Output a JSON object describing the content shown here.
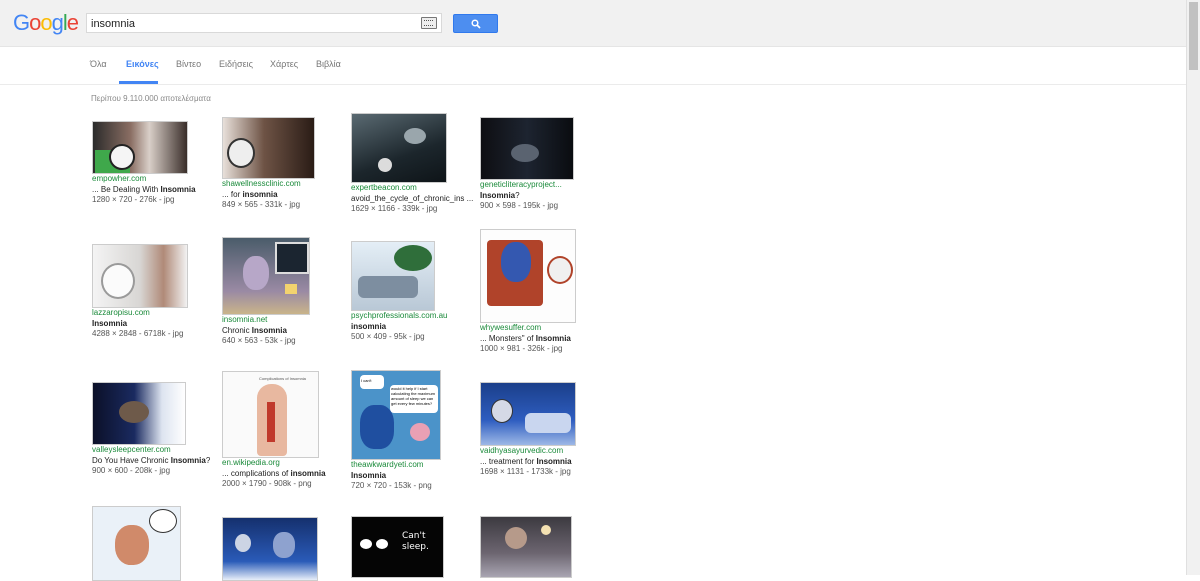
{
  "header": {
    "logo_text": "Google",
    "search_value": "insomnia"
  },
  "tabs": [
    "Όλα",
    "Εικόνες",
    "Βίντεο",
    "Ειδήσεις",
    "Χάρτες",
    "Βιβλία"
  ],
  "result_count": "Περίπου 9.110.000 αποτελέσματα",
  "results": [
    {
      "source": "empowher.com",
      "caption_pre": "... Be Dealing With ",
      "caption_bold": "Insomnia",
      "caption_post": "",
      "meta": "1280 × 720 - 276k - jpg"
    },
    {
      "source": "shawellnessclinic.com",
      "caption_pre": "... for ",
      "caption_bold": "insomnia",
      "caption_post": "",
      "meta": "849 × 565 - 331k - jpg"
    },
    {
      "source": "expertbeacon.com",
      "caption_pre": "avoid_the_cycle_of_chronic_ins ...",
      "caption_bold": "",
      "caption_post": "",
      "meta": "1629 × 1166 - 339k - jpg"
    },
    {
      "source": "geneticliteracyproject...",
      "caption_pre": "",
      "caption_bold": "Insomnia",
      "caption_post": "?",
      "meta": "900 × 598 - 195k - jpg"
    },
    {
      "source": "lazzaropisu.com",
      "caption_pre": "",
      "caption_bold": "Insomnia",
      "caption_post": "",
      "meta": "4288 × 2848 - 6718k - jpg"
    },
    {
      "source": "insomnia.net",
      "caption_pre": "Chronic ",
      "caption_bold": "Insomnia",
      "caption_post": "",
      "meta": "640 × 563 - 53k - jpg"
    },
    {
      "source": "psychprofessionals.com.au",
      "caption_pre": "",
      "caption_bold": "insomnia",
      "caption_post": "",
      "meta": "500 × 409 - 95k - jpg"
    },
    {
      "source": "whywesuffer.com",
      "caption_pre": "... Monsters\" of ",
      "caption_bold": "Insomnia",
      "caption_post": "",
      "meta": "1000 × 981 - 326k - jpg"
    },
    {
      "source": "valleysleepcenter.com",
      "caption_pre": "Do You Have Chronic ",
      "caption_bold": "Insomnia",
      "caption_post": "?",
      "meta": "900 × 600 - 208k - jpg"
    },
    {
      "source": "en.wikipedia.org",
      "caption_pre": "... complications of ",
      "caption_bold": "insomnia",
      "caption_post": "",
      "meta": "2000 × 1790 - 908k - png"
    },
    {
      "source": "theawkwardyeti.com",
      "caption_pre": "",
      "caption_bold": "Insomnia",
      "caption_post": "",
      "meta": "720 × 720 - 153k - png"
    },
    {
      "source": "vaidhyasayurvedic.com",
      "caption_pre": "... treatment for ",
      "caption_bold": "Insomnia",
      "caption_post": "",
      "meta": "1698 × 1131 - 1733k - jpg"
    }
  ],
  "thumb_texts": {
    "wiki_title": "Complications of Insomnia",
    "yeti_bubble1": "I can't sleep.",
    "yeti_bubble2": "would it help if I start calculating the maximum amount of sleep we can get every few minutes?",
    "cant_sleep": "Can't sleep."
  },
  "colors": {
    "accent": "#4285f4",
    "source_green": "#1a8a3a"
  }
}
